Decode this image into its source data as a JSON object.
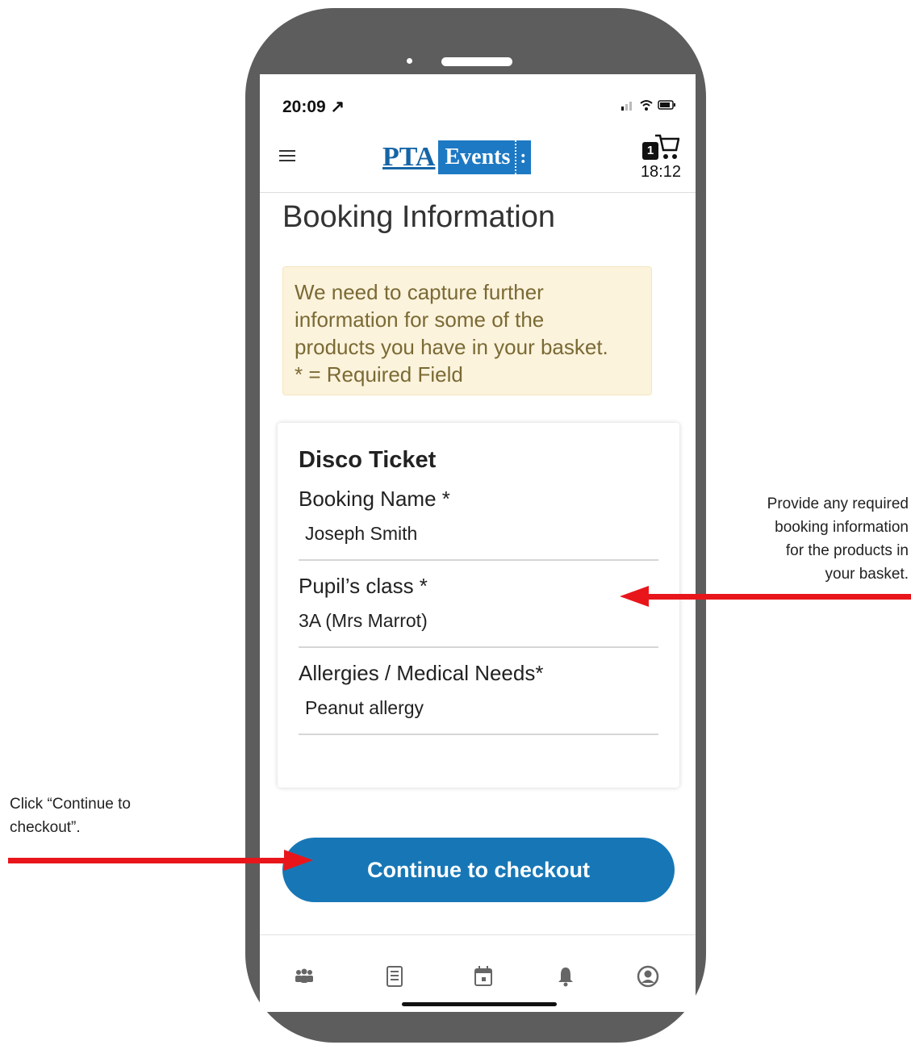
{
  "status_bar": {
    "time": "20:09 ↗",
    "icons": "signal wifi battery"
  },
  "header": {
    "logo_part1": "PTA",
    "logo_part2": "Events",
    "cart_count": "1",
    "cart_timer": "18:12"
  },
  "page": {
    "title": "Booking Information",
    "alert_lines": [
      "We need to capture further",
      "information for some of the",
      "products you have in your basket.",
      "* = Required Field"
    ]
  },
  "product_card": {
    "title": "Disco Ticket",
    "fields": [
      {
        "label": "Booking Name *",
        "value": "Joseph Smith"
      },
      {
        "label": "Pupil’s class *",
        "value": "3A (Mrs Marrot)"
      },
      {
        "label": "Allergies / Medical Needs*",
        "value": "Peanut allergy"
      }
    ]
  },
  "checkout_button": {
    "label": "Continue to checkout",
    "color": "#1777b6"
  },
  "bottom_nav": [
    "groups-icon",
    "list-icon",
    "calendar-icon",
    "bell-icon",
    "account-icon"
  ],
  "annotations": {
    "right": [
      "Provide any required",
      "booking information",
      "for the products in",
      "your basket."
    ],
    "left": [
      "Click “Continue to",
      "checkout”."
    ]
  },
  "colors": {
    "arrow": "#e8161b",
    "brand": "#1d79c3",
    "alert_bg": "#fcf3dd"
  }
}
